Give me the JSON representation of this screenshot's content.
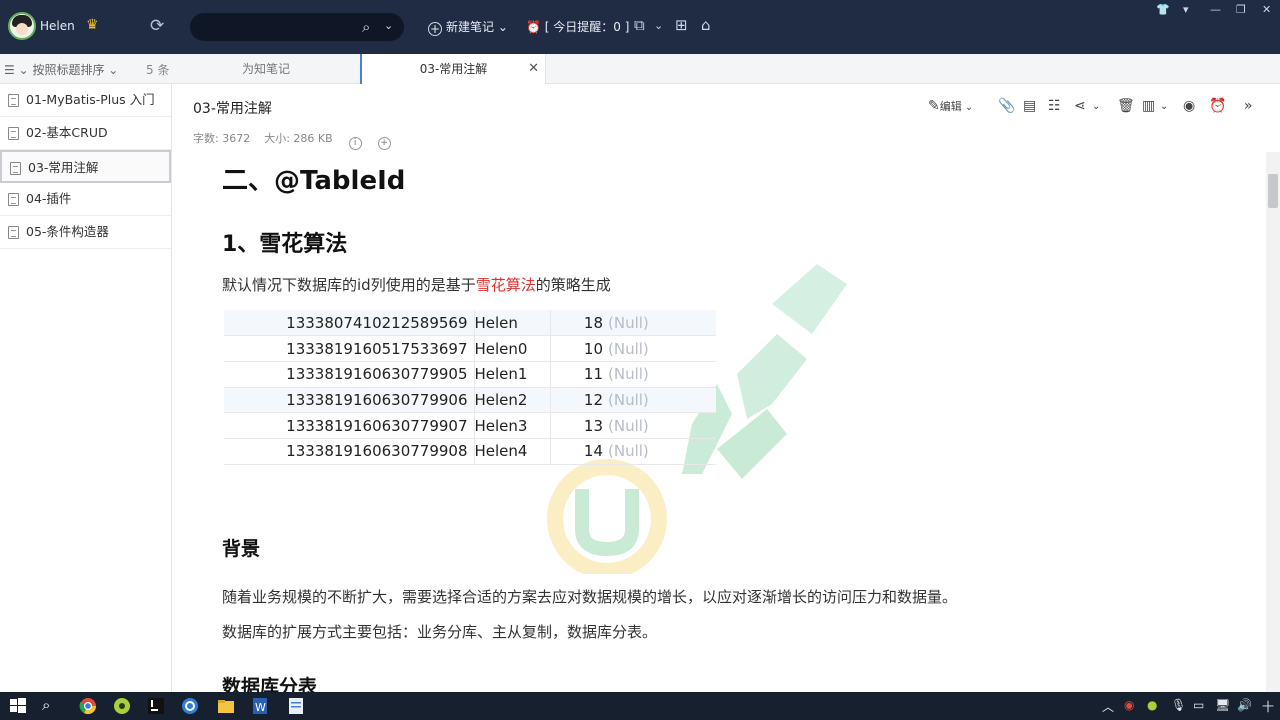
{
  "header": {
    "username": "Helen",
    "new_note_label": "新建笔记",
    "reminder_label": "[ 今日提醒：0 ]",
    "search_value": "",
    "search_placeholder": ""
  },
  "subbar": {
    "sort_label": "按照标题排序",
    "count_label": "5 条",
    "tabs": [
      {
        "label": "为知笔记"
      },
      {
        "label": "03-常用注解"
      }
    ]
  },
  "sidebar": {
    "items": [
      {
        "label": "01-MyBatis-Plus 入门"
      },
      {
        "label": "02-基本CRUD"
      },
      {
        "label": "03-常用注解"
      },
      {
        "label": "04-插件"
      },
      {
        "label": "05-条件构造器"
      }
    ]
  },
  "note": {
    "title": "03-常用注解",
    "word_count": "字数: 3672",
    "size": "大小: 286 KB",
    "edit_label": "编辑"
  },
  "doc": {
    "h1": "二、@TableId",
    "h2": "1、雪花算法",
    "para1_before": "默认情况下数据库的id列使用的是基于",
    "para1_red": "雪花算法",
    "para1_after": "的策略生成",
    "table": [
      {
        "id": "1333807410212589569",
        "name": "Helen",
        "age": "18",
        "email": "(Null)"
      },
      {
        "id": "1333819160517533697",
        "name": "Helen0",
        "age": "10",
        "email": "(Null)"
      },
      {
        "id": "1333819160630779905",
        "name": "Helen1",
        "age": "11",
        "email": "(Null)"
      },
      {
        "id": "1333819160630779906",
        "name": "Helen2",
        "age": "12",
        "email": "(Null)"
      },
      {
        "id": "1333819160630779907",
        "name": "Helen3",
        "age": "13",
        "email": "(Null)"
      },
      {
        "id": "1333819160630779908",
        "name": "Helen4",
        "age": "14",
        "email": "(Null)"
      }
    ],
    "h_background": "背景",
    "para2": "随着业务规模的不断扩大，需要选择合适的方案去应对数据规模的增长，以应对逐渐增长的访问压力和数据量。",
    "para3": "数据库的扩展方式主要包括：业务分库、主从复制，数据库分表。",
    "h_db_split": "数据库分表"
  },
  "taskbar": {
    "clock": "十"
  },
  "colors": {
    "header_bg": "#1f2c44",
    "accent_blue": "#4a7fd6",
    "highlight_red": "#e02f2f",
    "taskbar_bg": "#16202e"
  }
}
